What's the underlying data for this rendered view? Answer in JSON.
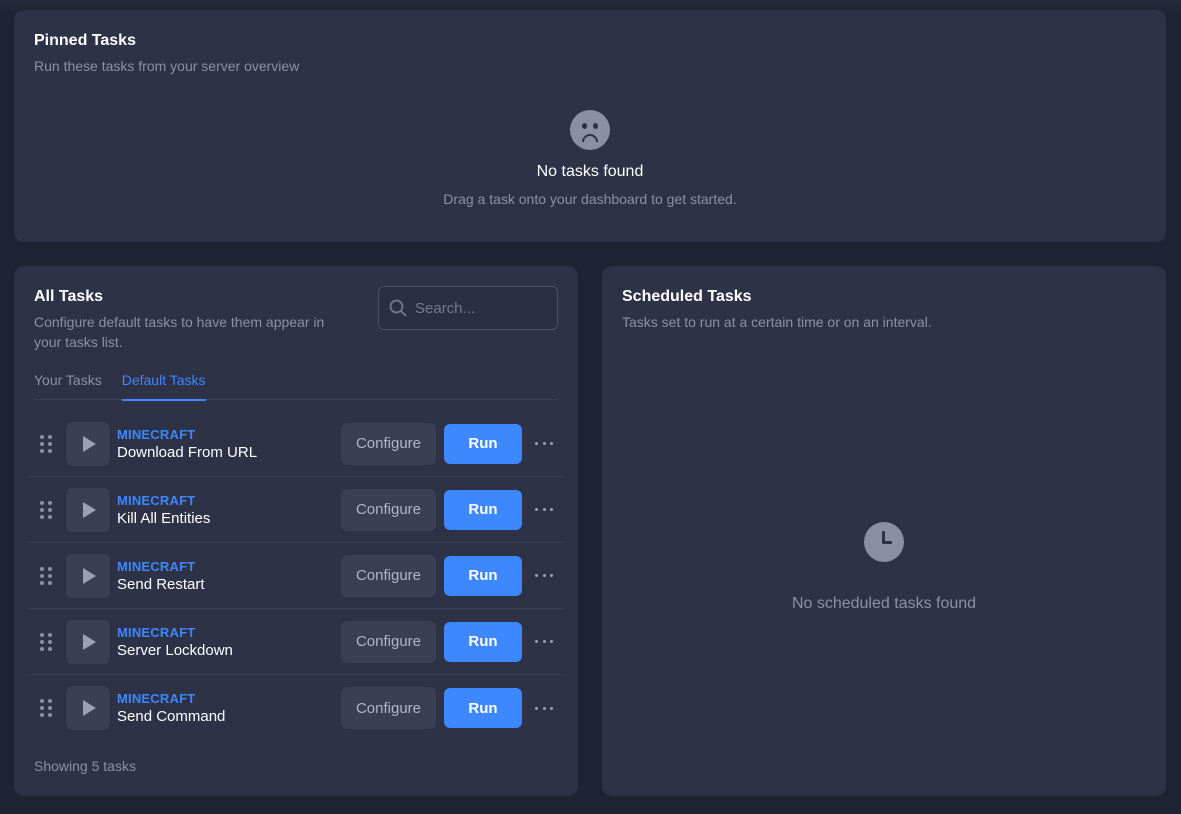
{
  "pinned": {
    "title": "Pinned Tasks",
    "subtitle": "Run these tasks from your server overview",
    "empty_icon": "sad-face-icon",
    "empty_title": "No tasks found",
    "empty_subtitle": "Drag a task onto your dashboard to get started."
  },
  "all_tasks": {
    "title": "All Tasks",
    "subtitle": "Configure default tasks to have them appear in your tasks list.",
    "search_placeholder": "Search...",
    "tabs": [
      {
        "label": "Your Tasks",
        "active": false
      },
      {
        "label": "Default Tasks",
        "active": true
      }
    ],
    "tasks": [
      {
        "category": "MINECRAFT",
        "name": "Download From URL"
      },
      {
        "category": "MINECRAFT",
        "name": "Kill All Entities"
      },
      {
        "category": "MINECRAFT",
        "name": "Send Restart"
      },
      {
        "category": "MINECRAFT",
        "name": "Server Lockdown"
      },
      {
        "category": "MINECRAFT",
        "name": "Send Command"
      }
    ],
    "configure_label": "Configure",
    "run_label": "Run",
    "footer": "Showing 5 tasks"
  },
  "scheduled": {
    "title": "Scheduled Tasks",
    "subtitle": "Tasks set to run at a certain time or on an interval.",
    "empty_icon": "clock-icon",
    "empty_text": "No scheduled tasks found"
  },
  "colors": {
    "accent": "#3d87ff",
    "panel": "#2d3247",
    "background": "#1f2333"
  }
}
